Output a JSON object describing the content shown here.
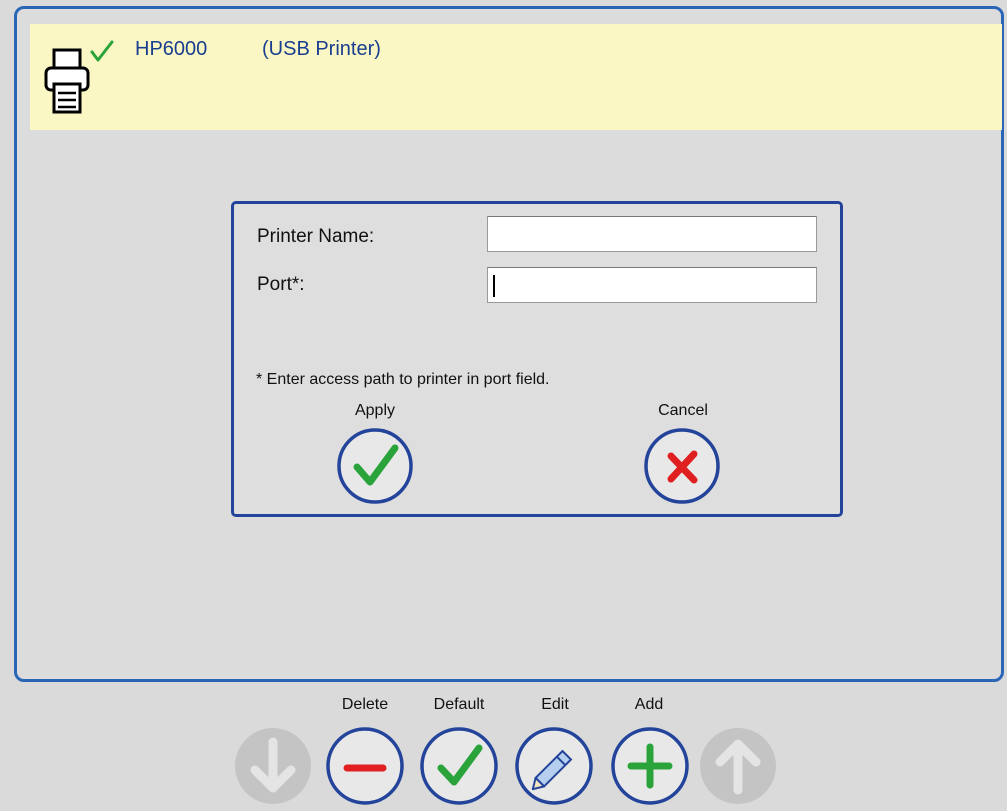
{
  "printer": {
    "name": "HP6000",
    "type": "(USB Printer)"
  },
  "dialog": {
    "printer_name_label": "Printer Name:",
    "printer_name_value": "",
    "port_label": "Port*:",
    "port_value": "",
    "note": "* Enter access path to printer in port field.",
    "apply_label": "Apply",
    "cancel_label": "Cancel"
  },
  "toolbar": {
    "delete_label": "Delete",
    "default_label": "Default",
    "edit_label": "Edit",
    "add_label": "Add"
  },
  "colors": {
    "accent_blue": "#2a66b8",
    "dark_blue": "#23449a",
    "header_bg": "#fbf7c4",
    "check_green": "#2aa33a",
    "cancel_red": "#e02020",
    "disabled_gray": "#c4c4c4"
  },
  "icons": {
    "printer": "printer-icon",
    "default_check": "checkmark-icon",
    "apply": "checkmark-icon",
    "cancel": "x-icon",
    "delete": "minus-icon",
    "edit": "pencil-icon",
    "add": "plus-icon",
    "move_down": "arrow-down-icon",
    "move_up": "arrow-up-icon"
  }
}
